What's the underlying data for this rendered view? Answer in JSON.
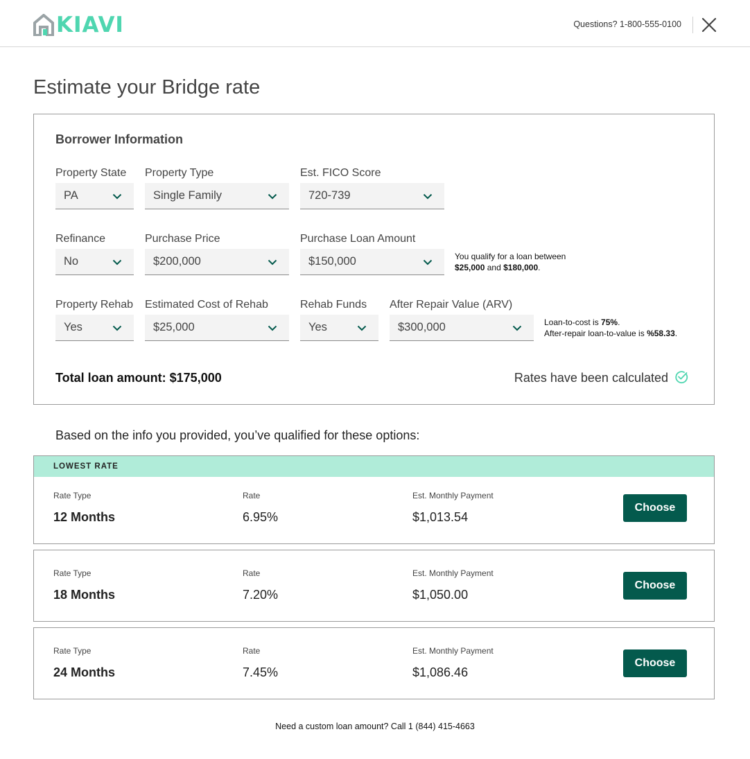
{
  "header": {
    "brand": "KIAVI",
    "phone_label": "Questions? 1-800-555-0100"
  },
  "page_title": "Estimate your Bridge rate",
  "borrower": {
    "title": "Borrower Information",
    "fields": {
      "property_state": {
        "label": "Property State",
        "value": "PA"
      },
      "property_type": {
        "label": "Property Type",
        "value": "Single Family"
      },
      "fico": {
        "label": "Est. FICO Score",
        "value": "720-739"
      },
      "refinance": {
        "label": "Refinance",
        "value": "No"
      },
      "purchase_price": {
        "label": "Purchase Price",
        "value": "$200,000"
      },
      "purchase_loan": {
        "label": "Purchase Loan Amount",
        "value": "$150,000"
      },
      "property_rehab": {
        "label": "Property Rehab",
        "value": "Yes"
      },
      "rehab_cost": {
        "label": "Estimated Cost of Rehab",
        "value": "$25,000"
      },
      "rehab_funds": {
        "label": "Rehab Funds",
        "value": "Yes"
      },
      "arv": {
        "label": "After Repair Value (ARV)",
        "value": "$300,000"
      }
    },
    "qualify_note": {
      "line1": "You qualify for a loan between",
      "min": "$25,000",
      "and": " and ",
      "max": "$180,000",
      "end": "."
    },
    "ratio_note": {
      "ltc_prefix": "Loan-to-cost is ",
      "ltc_value": "75%",
      "ltc_end": ".",
      "arv_prefix": "After-repair loan-to-value is ",
      "arv_value": "%58.33",
      "arv_end": "."
    },
    "total_loan": "Total loan amount: $175,000",
    "calculated": "Rates have been calculated"
  },
  "qualified_text": "Based on the info you provided, you’ve qualified for these options:",
  "rate_labels": {
    "type": "Rate Type",
    "rate": "Rate",
    "payment": "Est. Monthly Payment",
    "choose": "Choose",
    "badge": "LOWEST RATE"
  },
  "options": [
    {
      "term": "12 Months",
      "rate": "6.95%",
      "payment": "$1,013.54"
    },
    {
      "term": "18 Months",
      "rate": "7.20%",
      "payment": "$1,050.00"
    },
    {
      "term": "24 Months",
      "rate": "7.45%",
      "payment": "$1,086.46"
    }
  ],
  "footer": "Need a custom loan amount? Call 1 (844) 415-4663",
  "colors": {
    "brand": "#4fd6b0",
    "button": "#045a4d",
    "badge": "#b0ecd9",
    "chevron": "#045a4d",
    "check": "#4fd6b0"
  },
  "icons": {
    "logo": "house-icon",
    "close": "close-icon",
    "dropdown": "chevron-down-icon",
    "calculated": "check-circle-icon"
  }
}
